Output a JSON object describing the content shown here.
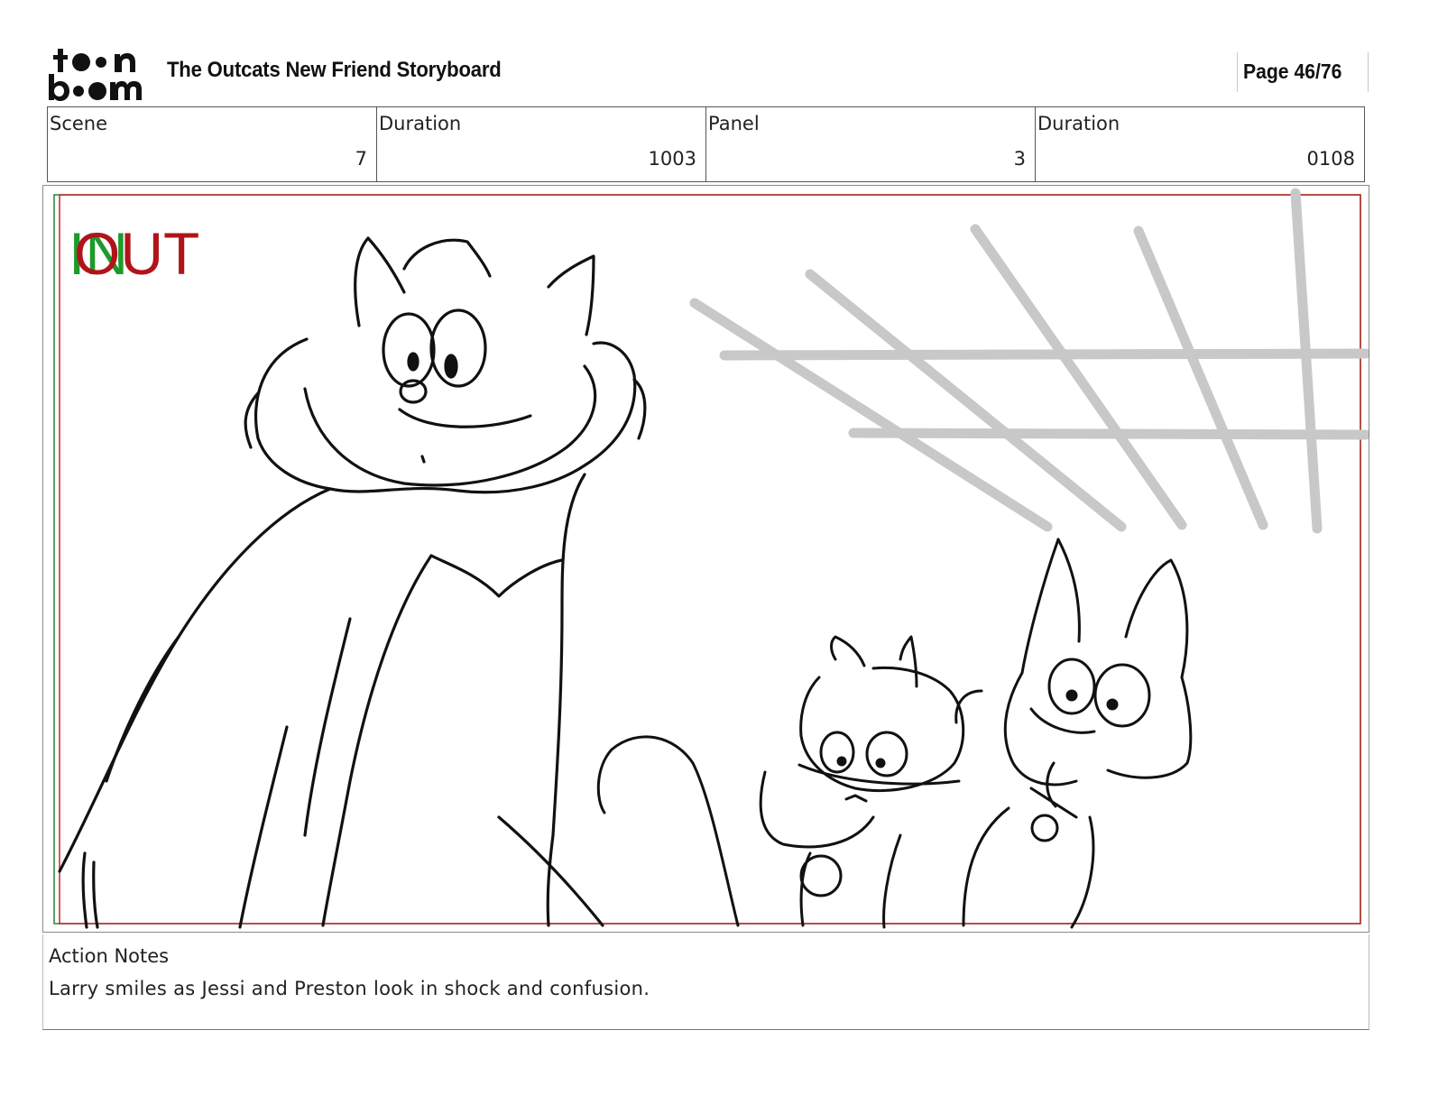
{
  "header": {
    "logo_text": "toon boom",
    "title": "The Outcats New Friend Storyboard",
    "page_label": "Page 46/76"
  },
  "info": {
    "scene_label": "Scene",
    "scene_value": "7",
    "scene_duration_label": "Duration",
    "scene_duration_value": "1003",
    "panel_label": "Panel",
    "panel_value": "3",
    "panel_duration_label": "Duration",
    "panel_duration_value": "0108"
  },
  "panel": {
    "in_marker": "IN",
    "out_marker": "OUT",
    "in_color": "#1e9a2c",
    "out_color": "#b0141a",
    "safe_frame_red": "#c0282a",
    "safe_frame_green": "#1e8a30"
  },
  "notes": {
    "label": "Action Notes",
    "text": "Larry smiles as Jessi and Preston look in shock and confusion."
  }
}
